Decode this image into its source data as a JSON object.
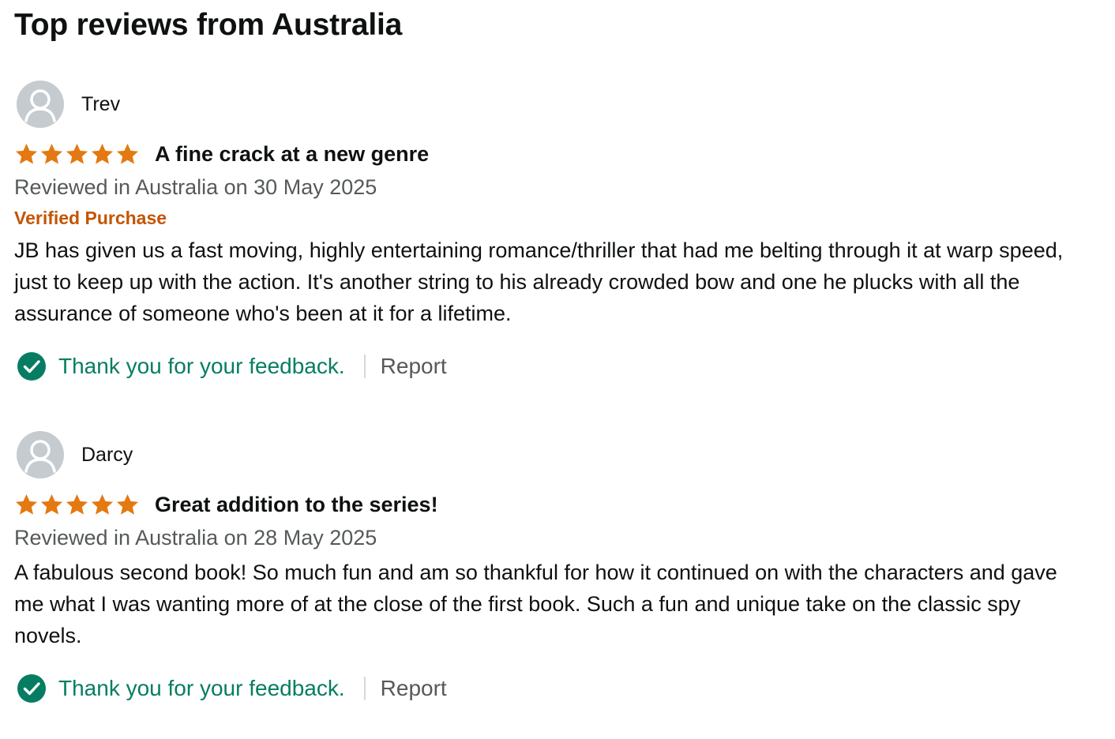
{
  "section": {
    "title": "Top reviews from Australia"
  },
  "colors": {
    "star": "#e47911",
    "verified": "#c45500",
    "feedback": "#067d62",
    "check": "#067d62",
    "avatar_bg": "#c5cbcf"
  },
  "reviews": [
    {
      "author": "Trev",
      "rating": 5,
      "rating_max": 5,
      "title": "A fine crack at a new genre",
      "date_text": "Reviewed in Australia on 30 May 2025",
      "verified_label": "Verified Purchase",
      "body": "JB has given us a fast moving, highly entertaining romance/thriller that had me belting through it at warp speed, just to keep up with the action. It's another string to his already crowded bow and one he plucks with all the assurance of someone who's been at it for a lifetime.",
      "feedback_text": "Thank you for your feedback.",
      "report_label": "Report"
    },
    {
      "author": "Darcy",
      "rating": 5,
      "rating_max": 5,
      "title": "Great addition to the series!",
      "date_text": "Reviewed in Australia on 28 May 2025",
      "body": "A fabulous second book! So much fun and am so thankful for how it continued on with the characters and gave me what I was wanting more of at the close of the first book. Such a fun and unique take on the classic spy novels.",
      "feedback_text": "Thank you for your feedback.",
      "report_label": "Report"
    }
  ],
  "icons": {
    "avatar": "user-silhouette-icon",
    "star": "star-icon",
    "check": "check-circle-icon"
  }
}
